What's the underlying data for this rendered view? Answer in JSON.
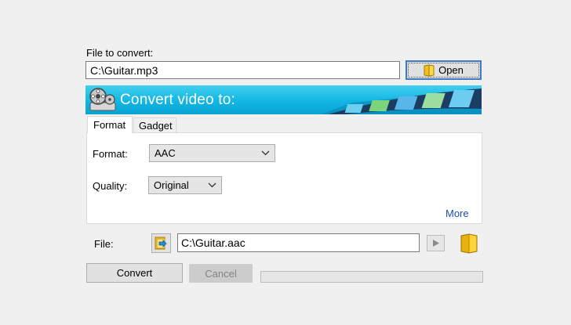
{
  "source": {
    "label": "File to convert:",
    "value": "C:\\Guitar.mp3",
    "open_label": "Open"
  },
  "banner": {
    "title": "Convert video to:"
  },
  "tabs": [
    {
      "label": "Format",
      "active": true
    },
    {
      "label": "Gadget",
      "active": false
    }
  ],
  "settings": {
    "format_label": "Format:",
    "format_value": "AAC",
    "quality_label": "Quality:",
    "quality_value": "Original",
    "more_label": "More"
  },
  "output": {
    "label": "File:",
    "value": "C:\\Guitar.aac"
  },
  "actions": {
    "convert_label": "Convert",
    "cancel_label": "Cancel"
  },
  "progress": {
    "fraction": 0
  },
  "colors": {
    "banner": "#12b6e3",
    "link": "#1c4fa5",
    "focus_border": "#3d7bc4",
    "folder": "#f3c020"
  },
  "icons": {
    "open": "folder-icon",
    "banner": "film-reel-icon",
    "output_action": "output-file-icon",
    "preview": "play-icon",
    "browse": "folder-icon"
  }
}
